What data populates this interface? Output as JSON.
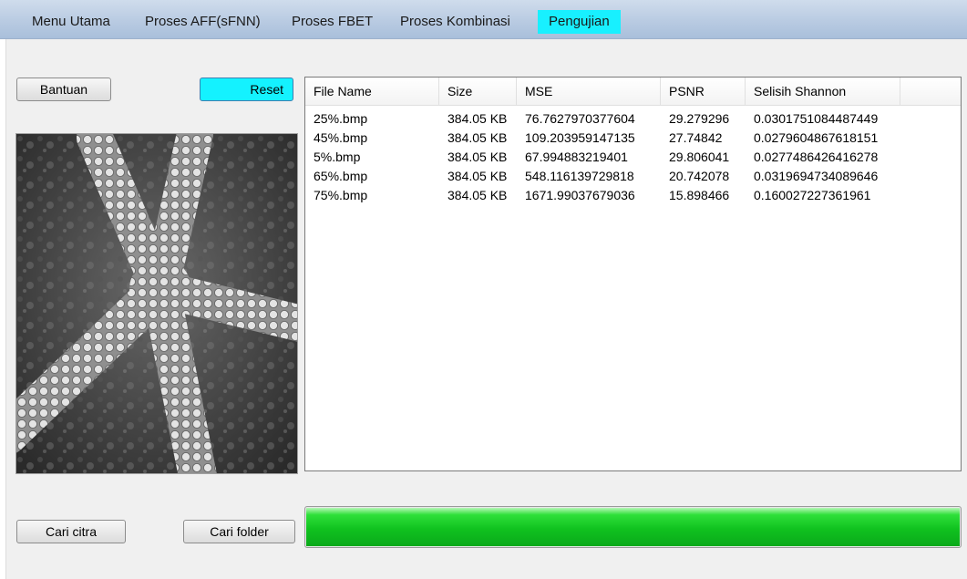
{
  "menu": {
    "items": [
      {
        "label": "Menu Utama",
        "active": false
      },
      {
        "label": "Proses AFF(sFNN)",
        "active": false
      },
      {
        "label": "Proses FBET",
        "active": false
      },
      {
        "label": "Proses Kombinasi",
        "active": false
      },
      {
        "label": "Pengujian",
        "active": true
      }
    ],
    "active_color": "#18f0ff"
  },
  "buttons": {
    "bantuan": "Bantuan",
    "reset": "Reset",
    "cari_citra": "Cari citra",
    "cari_folder": "Cari folder"
  },
  "image_preview": {
    "icon": "starfish-image"
  },
  "table": {
    "columns": [
      "File Name",
      "Size",
      "MSE",
      "PSNR",
      "Selisih Shannon"
    ],
    "rows": [
      [
        "25%.bmp",
        "384.05 KB",
        "76.7627970377604",
        "29.279296",
        "0.0301751084487449"
      ],
      [
        "45%.bmp",
        "384.05 KB",
        "109.203959147135",
        "27.74842",
        "0.0279604867618151"
      ],
      [
        "5%.bmp",
        "384.05 KB",
        "67.994883219401",
        "29.806041",
        "0.0277486426416278"
      ],
      [
        "65%.bmp",
        "384.05 KB",
        "548.116139729818",
        "20.742078",
        "0.0319694734089646"
      ],
      [
        "75%.bmp",
        "384.05 KB",
        "1671.99037679036",
        "15.898466",
        "0.160027227361961"
      ]
    ]
  },
  "progress": {
    "value": 1.0,
    "color": "#10c21f"
  }
}
